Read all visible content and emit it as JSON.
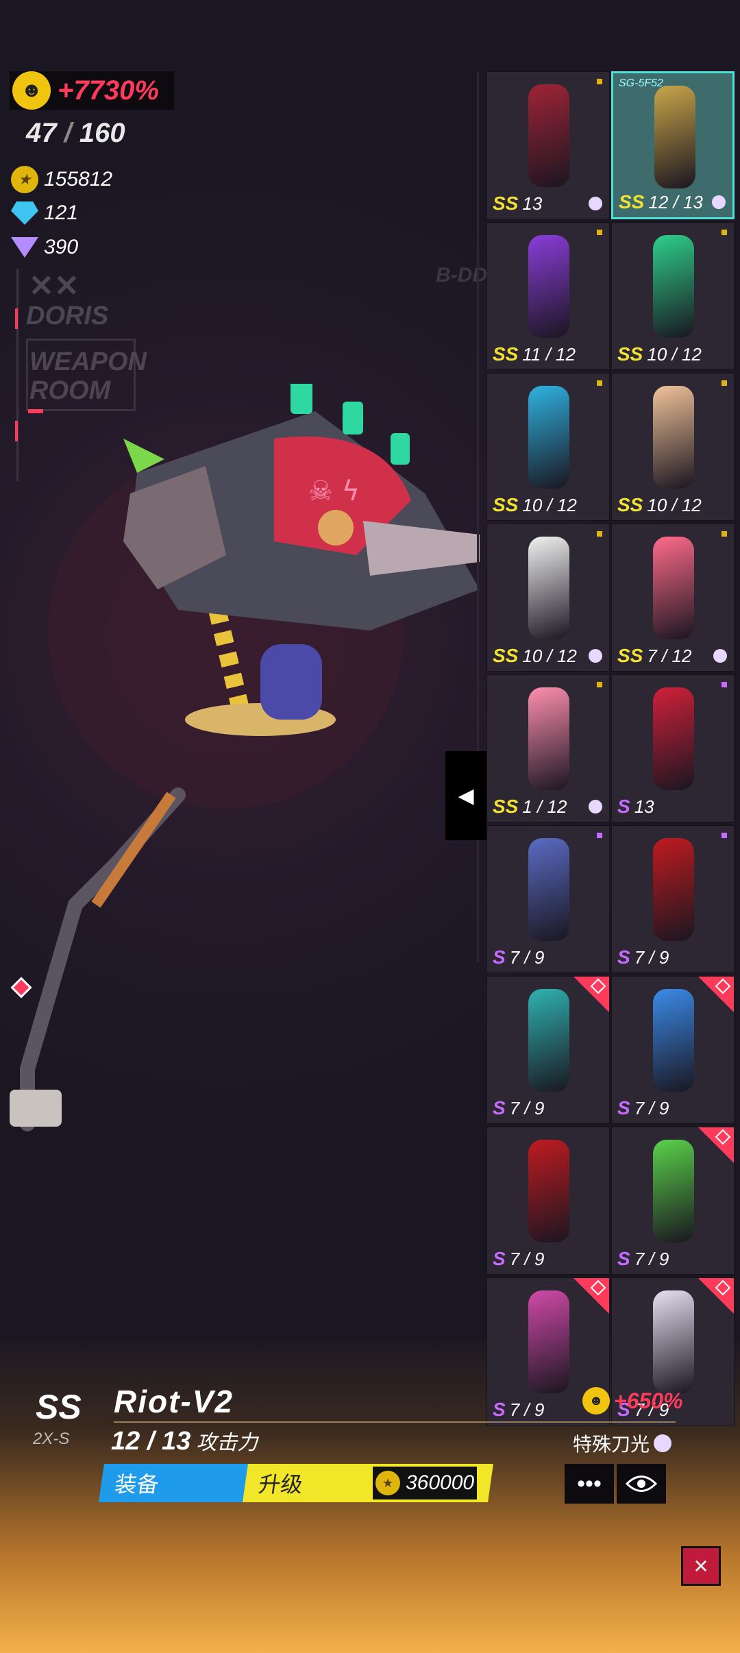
{
  "hud": {
    "bonus": "+7730%",
    "weapons_owned": "47",
    "weapons_total": "160",
    "gold": "155812",
    "diamonds": "121",
    "crystals": "390",
    "side_doris": "DORIS",
    "side_weapon_room": "WEAPON ROOM",
    "tag_bdd": "B-DD"
  },
  "grid": {
    "selected_code": "SG-5F52",
    "items": [
      {
        "tier": "SS",
        "level": "13",
        "dot": "gold",
        "orb": true,
        "color": "#a02436"
      },
      {
        "tier": "SS",
        "level": "12 / 13",
        "dot": "none",
        "orb": true,
        "color": "#c9a64a",
        "selected": true
      },
      {
        "tier": "SS",
        "level": "11 / 12",
        "dot": "gold",
        "orb": false,
        "color": "#8a3dd8"
      },
      {
        "tier": "SS",
        "level": "10 / 12",
        "dot": "gold",
        "orb": false,
        "color": "#2ecf8a"
      },
      {
        "tier": "SS",
        "level": "10 / 12",
        "dot": "gold",
        "orb": false,
        "color": "#2fb2e0"
      },
      {
        "tier": "SS",
        "level": "10 / 12",
        "dot": "gold",
        "orb": false,
        "color": "#f1c39a"
      },
      {
        "tier": "SS",
        "level": "10 / 12",
        "dot": "gold",
        "orb": true,
        "color": "#f2f2f2"
      },
      {
        "tier": "SS",
        "level": "7 / 12",
        "dot": "gold",
        "orb": true,
        "color": "#ff6b8a"
      },
      {
        "tier": "SS",
        "level": "1 / 12",
        "dot": "gold",
        "orb": true,
        "color": "#ff8fb0"
      },
      {
        "tier": "S",
        "level": "13",
        "dot": "purple",
        "orb": false,
        "color": "#d0203a"
      },
      {
        "tier": "S",
        "level": "7 / 9",
        "dot": "purple",
        "orb": false,
        "color": "#5a6cc4"
      },
      {
        "tier": "S",
        "level": "7 / 9",
        "dot": "purple",
        "orb": false,
        "color": "#c01b20"
      },
      {
        "tier": "S",
        "level": "7 / 9",
        "dot": "corner",
        "orb": false,
        "color": "#2fb2b0"
      },
      {
        "tier": "S",
        "level": "7 / 9",
        "dot": "corner",
        "orb": false,
        "color": "#3b8be8"
      },
      {
        "tier": "S",
        "level": "7 / 9",
        "dot": "none",
        "orb": false,
        "color": "#c01b20"
      },
      {
        "tier": "S",
        "level": "7 / 9",
        "dot": "corner",
        "orb": false,
        "color": "#5ad24a"
      },
      {
        "tier": "S",
        "level": "7 / 9",
        "dot": "corner",
        "orb": false,
        "color": "#d04aa8"
      },
      {
        "tier": "S",
        "level": "7 / 9",
        "dot": "corner",
        "orb": false,
        "color": "#e6e0f2"
      }
    ]
  },
  "detail": {
    "rank": "SS",
    "rank_sub": "2X-S",
    "name": "Riot-V2",
    "level": "12 / 13",
    "attack_label": "攻击力",
    "equip_label": "装备",
    "upgrade_label": "升级",
    "upgrade_cost": "360000",
    "bonus": "+650%",
    "special_label": "特殊刀光",
    "more_icon": "•••",
    "view_icon": "eye-icon",
    "close_icon": "×"
  },
  "colors": {
    "accent_red": "#ff3b5c",
    "gold": "#f2e232",
    "purple": "#c66bff",
    "equip_blue": "#1e9bea",
    "upgrade_yellow": "#f1e628"
  }
}
